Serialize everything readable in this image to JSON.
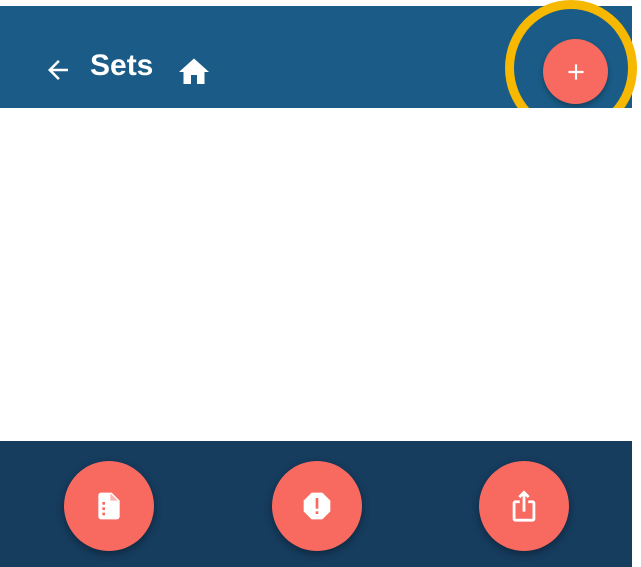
{
  "app_bar": {
    "title": "Sets",
    "back_icon": "arrow-left-icon",
    "home_icon": "home-icon",
    "add_icon": "plus-icon"
  },
  "bottom_bar": {
    "buttons": [
      {
        "icon": "file-document-icon"
      },
      {
        "icon": "alert-icon"
      },
      {
        "icon": "share-upload-icon"
      }
    ]
  },
  "colors": {
    "app_bar": "#1a5c87",
    "bottom_bar": "#163c5e",
    "fab": "#f8695f",
    "highlight_ring": "#f6b800"
  }
}
